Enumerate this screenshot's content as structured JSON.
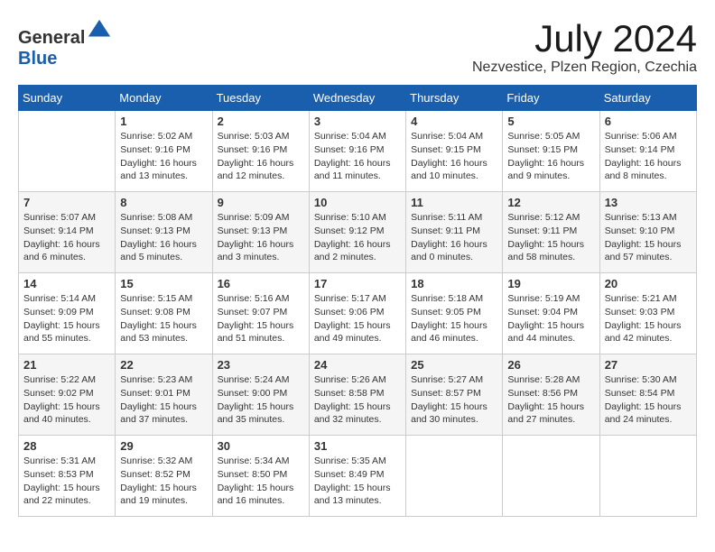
{
  "header": {
    "logo_general": "General",
    "logo_blue": "Blue",
    "month_year": "July 2024",
    "location": "Nezvestice, Plzen Region, Czechia"
  },
  "weekdays": [
    "Sunday",
    "Monday",
    "Tuesday",
    "Wednesday",
    "Thursday",
    "Friday",
    "Saturday"
  ],
  "weeks": [
    [
      {
        "day": "",
        "sunrise": "",
        "sunset": "",
        "daylight": ""
      },
      {
        "day": "1",
        "sunrise": "Sunrise: 5:02 AM",
        "sunset": "Sunset: 9:16 PM",
        "daylight": "Daylight: 16 hours and 13 minutes."
      },
      {
        "day": "2",
        "sunrise": "Sunrise: 5:03 AM",
        "sunset": "Sunset: 9:16 PM",
        "daylight": "Daylight: 16 hours and 12 minutes."
      },
      {
        "day": "3",
        "sunrise": "Sunrise: 5:04 AM",
        "sunset": "Sunset: 9:16 PM",
        "daylight": "Daylight: 16 hours and 11 minutes."
      },
      {
        "day": "4",
        "sunrise": "Sunrise: 5:04 AM",
        "sunset": "Sunset: 9:15 PM",
        "daylight": "Daylight: 16 hours and 10 minutes."
      },
      {
        "day": "5",
        "sunrise": "Sunrise: 5:05 AM",
        "sunset": "Sunset: 9:15 PM",
        "daylight": "Daylight: 16 hours and 9 minutes."
      },
      {
        "day": "6",
        "sunrise": "Sunrise: 5:06 AM",
        "sunset": "Sunset: 9:14 PM",
        "daylight": "Daylight: 16 hours and 8 minutes."
      }
    ],
    [
      {
        "day": "7",
        "sunrise": "Sunrise: 5:07 AM",
        "sunset": "Sunset: 9:14 PM",
        "daylight": "Daylight: 16 hours and 6 minutes."
      },
      {
        "day": "8",
        "sunrise": "Sunrise: 5:08 AM",
        "sunset": "Sunset: 9:13 PM",
        "daylight": "Daylight: 16 hours and 5 minutes."
      },
      {
        "day": "9",
        "sunrise": "Sunrise: 5:09 AM",
        "sunset": "Sunset: 9:13 PM",
        "daylight": "Daylight: 16 hours and 3 minutes."
      },
      {
        "day": "10",
        "sunrise": "Sunrise: 5:10 AM",
        "sunset": "Sunset: 9:12 PM",
        "daylight": "Daylight: 16 hours and 2 minutes."
      },
      {
        "day": "11",
        "sunrise": "Sunrise: 5:11 AM",
        "sunset": "Sunset: 9:11 PM",
        "daylight": "Daylight: 16 hours and 0 minutes."
      },
      {
        "day": "12",
        "sunrise": "Sunrise: 5:12 AM",
        "sunset": "Sunset: 9:11 PM",
        "daylight": "Daylight: 15 hours and 58 minutes."
      },
      {
        "day": "13",
        "sunrise": "Sunrise: 5:13 AM",
        "sunset": "Sunset: 9:10 PM",
        "daylight": "Daylight: 15 hours and 57 minutes."
      }
    ],
    [
      {
        "day": "14",
        "sunrise": "Sunrise: 5:14 AM",
        "sunset": "Sunset: 9:09 PM",
        "daylight": "Daylight: 15 hours and 55 minutes."
      },
      {
        "day": "15",
        "sunrise": "Sunrise: 5:15 AM",
        "sunset": "Sunset: 9:08 PM",
        "daylight": "Daylight: 15 hours and 53 minutes."
      },
      {
        "day": "16",
        "sunrise": "Sunrise: 5:16 AM",
        "sunset": "Sunset: 9:07 PM",
        "daylight": "Daylight: 15 hours and 51 minutes."
      },
      {
        "day": "17",
        "sunrise": "Sunrise: 5:17 AM",
        "sunset": "Sunset: 9:06 PM",
        "daylight": "Daylight: 15 hours and 49 minutes."
      },
      {
        "day": "18",
        "sunrise": "Sunrise: 5:18 AM",
        "sunset": "Sunset: 9:05 PM",
        "daylight": "Daylight: 15 hours and 46 minutes."
      },
      {
        "day": "19",
        "sunrise": "Sunrise: 5:19 AM",
        "sunset": "Sunset: 9:04 PM",
        "daylight": "Daylight: 15 hours and 44 minutes."
      },
      {
        "day": "20",
        "sunrise": "Sunrise: 5:21 AM",
        "sunset": "Sunset: 9:03 PM",
        "daylight": "Daylight: 15 hours and 42 minutes."
      }
    ],
    [
      {
        "day": "21",
        "sunrise": "Sunrise: 5:22 AM",
        "sunset": "Sunset: 9:02 PM",
        "daylight": "Daylight: 15 hours and 40 minutes."
      },
      {
        "day": "22",
        "sunrise": "Sunrise: 5:23 AM",
        "sunset": "Sunset: 9:01 PM",
        "daylight": "Daylight: 15 hours and 37 minutes."
      },
      {
        "day": "23",
        "sunrise": "Sunrise: 5:24 AM",
        "sunset": "Sunset: 9:00 PM",
        "daylight": "Daylight: 15 hours and 35 minutes."
      },
      {
        "day": "24",
        "sunrise": "Sunrise: 5:26 AM",
        "sunset": "Sunset: 8:58 PM",
        "daylight": "Daylight: 15 hours and 32 minutes."
      },
      {
        "day": "25",
        "sunrise": "Sunrise: 5:27 AM",
        "sunset": "Sunset: 8:57 PM",
        "daylight": "Daylight: 15 hours and 30 minutes."
      },
      {
        "day": "26",
        "sunrise": "Sunrise: 5:28 AM",
        "sunset": "Sunset: 8:56 PM",
        "daylight": "Daylight: 15 hours and 27 minutes."
      },
      {
        "day": "27",
        "sunrise": "Sunrise: 5:30 AM",
        "sunset": "Sunset: 8:54 PM",
        "daylight": "Daylight: 15 hours and 24 minutes."
      }
    ],
    [
      {
        "day": "28",
        "sunrise": "Sunrise: 5:31 AM",
        "sunset": "Sunset: 8:53 PM",
        "daylight": "Daylight: 15 hours and 22 minutes."
      },
      {
        "day": "29",
        "sunrise": "Sunrise: 5:32 AM",
        "sunset": "Sunset: 8:52 PM",
        "daylight": "Daylight: 15 hours and 19 minutes."
      },
      {
        "day": "30",
        "sunrise": "Sunrise: 5:34 AM",
        "sunset": "Sunset: 8:50 PM",
        "daylight": "Daylight: 15 hours and 16 minutes."
      },
      {
        "day": "31",
        "sunrise": "Sunrise: 5:35 AM",
        "sunset": "Sunset: 8:49 PM",
        "daylight": "Daylight: 15 hours and 13 minutes."
      },
      {
        "day": "",
        "sunrise": "",
        "sunset": "",
        "daylight": ""
      },
      {
        "day": "",
        "sunrise": "",
        "sunset": "",
        "daylight": ""
      },
      {
        "day": "",
        "sunrise": "",
        "sunset": "",
        "daylight": ""
      }
    ]
  ]
}
